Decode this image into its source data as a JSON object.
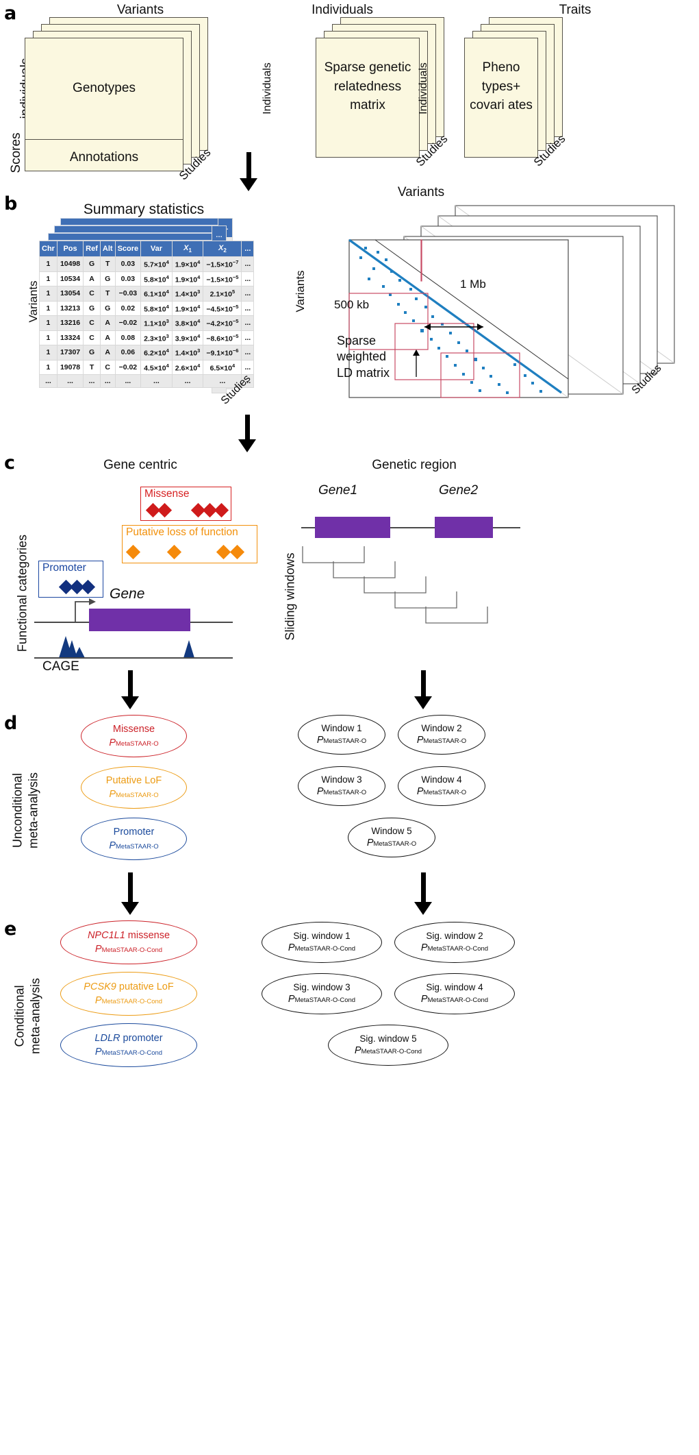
{
  "figure": {
    "panels": [
      "a",
      "b",
      "c",
      "d",
      "e"
    ]
  },
  "panel_a": {
    "letter": "a",
    "stacks": [
      {
        "top_label": "Variants",
        "left_label_top": "individuals",
        "left_label_bottom": "Scores",
        "depth_label": "Studies",
        "cells": [
          "Genotypes",
          "Annotations"
        ]
      },
      {
        "top_label": "Individuals",
        "left_label": "Individuals",
        "depth_label": "Studies",
        "cells": [
          "Sparse genetic relatedness matrix"
        ]
      },
      {
        "top_label": "Traits",
        "left_label": "Individuals",
        "depth_label": "Studies",
        "cells": [
          "Pheno types+ covari ates"
        ]
      }
    ]
  },
  "panel_b": {
    "letter": "b",
    "left_title": "Summary statistics",
    "left_axis_label": "Variants",
    "left_depth_label": "Studies",
    "table": {
      "columns": [
        "Chr",
        "Pos",
        "Ref",
        "Alt",
        "Score",
        "Var",
        "X1",
        "X2",
        "..."
      ],
      "rows": [
        [
          "1",
          "10498",
          "G",
          "T",
          "0.03",
          "5.7×10",
          "4",
          "1.9×10",
          "4",
          "−1.5×10",
          "−7",
          "..."
        ],
        [
          "1",
          "10534",
          "A",
          "G",
          "0.03",
          "5.8×10",
          "4",
          "1.9×10",
          "4",
          "−1.5×10",
          "−5",
          "..."
        ],
        [
          "1",
          "13054",
          "C",
          "T",
          "−0.03",
          "6.1×10",
          "4",
          "1.4×10",
          "3",
          "2.1×10",
          "5",
          "..."
        ],
        [
          "1",
          "13213",
          "G",
          "G",
          "0.02",
          "5.8×10",
          "4",
          "1.9×10",
          "4",
          "−4.5×10",
          "−5",
          "..."
        ],
        [
          "1",
          "13216",
          "C",
          "A",
          "−0.02",
          "1.1×10",
          "3",
          "3.8×10",
          "4",
          "−4.2×10",
          "−5",
          "..."
        ],
        [
          "1",
          "13324",
          "C",
          "A",
          "0.08",
          "2.3×10",
          "3",
          "3.9×10",
          "4",
          "−8.6×10",
          "−5",
          "..."
        ],
        [
          "1",
          "17307",
          "G",
          "A",
          "0.06",
          "6.2×10",
          "4",
          "1.4×10",
          "3",
          "−9.1×10",
          "−6",
          "..."
        ],
        [
          "1",
          "19078",
          "T",
          "C",
          "−0.02",
          "4.5×10",
          "4",
          "2.6×10",
          "4",
          "6.5×10",
          "4",
          "..."
        ],
        [
          "...",
          "...",
          "...",
          "...",
          "...",
          "...",
          "",
          "...",
          "",
          "...",
          "",
          "..."
        ]
      ]
    },
    "ld": {
      "top_label": "Variants",
      "left_label": "Variants",
      "depth_label": "Studies",
      "caption_line1": "Sparse",
      "caption_line2": "weighted",
      "caption_line3": "LD matrix",
      "annotation_1mb": "1 Mb",
      "annotation_500kb": "500 kb"
    }
  },
  "panel_c": {
    "letter": "c",
    "left_title": "Gene centric",
    "right_title": "Genetic region",
    "left_axis_label": "Functional categories",
    "right_axis_label": "Sliding windows",
    "categories": [
      {
        "name": "Missense",
        "color": "#d62021",
        "variants": 5
      },
      {
        "name": "Putative loss of function",
        "color": "#f2900a",
        "variants": 4
      },
      {
        "name": "Promoter",
        "color": "#1a46a0",
        "variants": 3
      }
    ],
    "gene_label": "Gene",
    "cage_label": "CAGE",
    "region_genes": [
      "Gene1",
      "Gene2"
    ]
  },
  "panel_d": {
    "letter": "d",
    "axis_label_line1": "Unconditional",
    "axis_label_line2": "meta-analysis",
    "left_results": [
      {
        "label": "Missense",
        "pvalue_sub": "MetaSTAAR-O",
        "color": "#cc2229"
      },
      {
        "label": "Putative LoF",
        "pvalue_sub": "MetaSTAAR-O",
        "color": "#ec9b13"
      },
      {
        "label": "Promoter",
        "pvalue_sub": "MetaSTAAR-O",
        "color": "#1b4a9c"
      }
    ],
    "right_results": [
      {
        "label": "Window 1",
        "pvalue_sub": "MetaSTAAR-O"
      },
      {
        "label": "Window 2",
        "pvalue_sub": "MetaSTAAR-O"
      },
      {
        "label": "Window 3",
        "pvalue_sub": "MetaSTAAR-O"
      },
      {
        "label": "Window 4",
        "pvalue_sub": "MetaSTAAR-O"
      },
      {
        "label": "Window 5",
        "pvalue_sub": "MetaSTAAR-O"
      }
    ],
    "p_symbol": "P"
  },
  "panel_e": {
    "letter": "e",
    "axis_label_line1": "Conditional",
    "axis_label_line2": "meta-analysis",
    "left_results": [
      {
        "gene": "NPC1L1",
        "suffix": " missense",
        "pvalue_sub": "MetaSTAAR-O-Cond",
        "color": "#cc2229"
      },
      {
        "gene": "PCSK9",
        "suffix": " putative LoF",
        "pvalue_sub": "MetaSTAAR-O-Cond",
        "color": "#ec9b13"
      },
      {
        "gene": "LDLR",
        "suffix": " promoter",
        "pvalue_sub": "MetaSTAAR-O-Cond",
        "color": "#1b4a9c"
      }
    ],
    "right_results": [
      {
        "label": "Sig. window 1",
        "pvalue_sub": "MetaSTAAR-O-Cond"
      },
      {
        "label": "Sig. window 2",
        "pvalue_sub": "MetaSTAAR-O-Cond"
      },
      {
        "label": "Sig. window 3",
        "pvalue_sub": "MetaSTAAR-O-Cond"
      },
      {
        "label": "Sig. window 4",
        "pvalue_sub": "MetaSTAAR-O-Cond"
      },
      {
        "label": "Sig. window 5",
        "pvalue_sub": "MetaSTAAR-O-Cond"
      }
    ],
    "p_symbol": "P"
  },
  "colors": {
    "card_fill": "#fbf8e0",
    "card_stroke": "#55524a",
    "table_header": "#3f6fb5",
    "gene_purple": "#7030a8",
    "cage_blue": "#1a3a8f",
    "ld_blue": "#1f7fc0",
    "ld_window_red": "#c74a63",
    "missense_red": "#d62021",
    "lof_orange": "#f2900a",
    "promoter_blue": "#1a46a0"
  }
}
